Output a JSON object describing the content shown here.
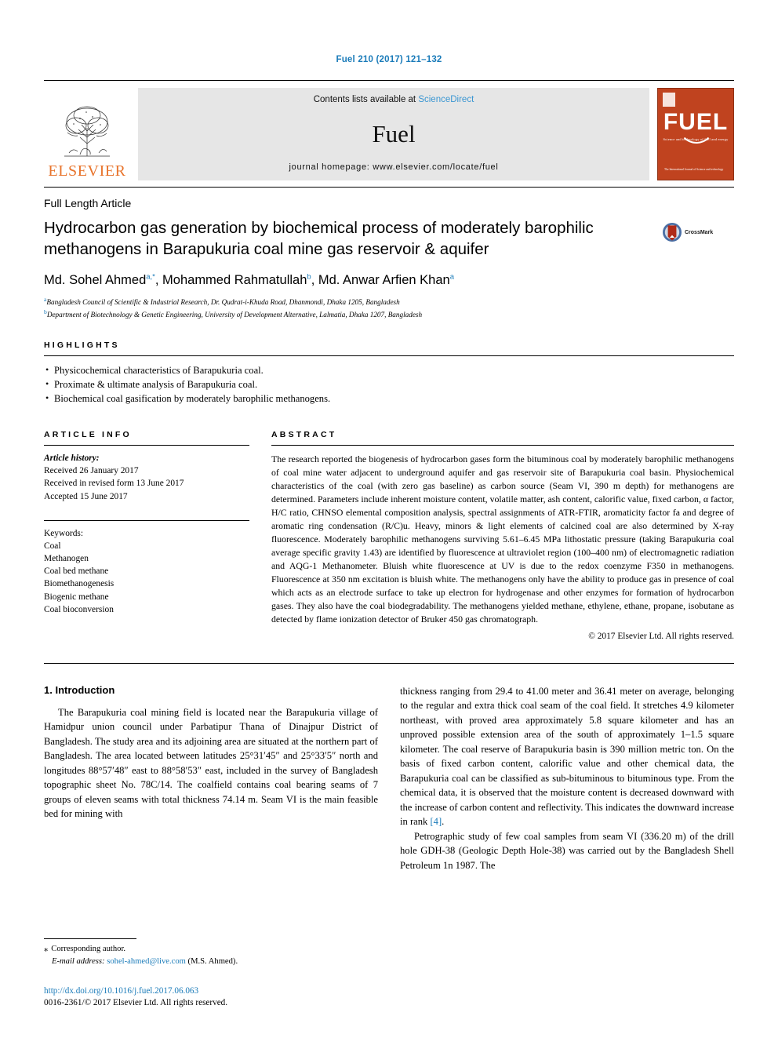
{
  "running_head": "Fuel 210 (2017) 121–132",
  "masthead": {
    "elsevier_wordmark": "ELSEVIER",
    "contents_prefix": "Contents lists available at",
    "contents_link": "ScienceDirect",
    "journal_name": "Fuel",
    "homepage_line": "journal homepage: www.elsevier.com/locate/fuel",
    "cover": {
      "title": "FUEL",
      "subtitle": "Science and technology of fuel and energy",
      "footer": "The International Journal of\nScience and technology"
    }
  },
  "article": {
    "type": "Full Length Article",
    "title": "Hydrocarbon gas generation by biochemical process of moderately barophilic methanogens in Barapukuria coal mine gas reservoir & aquifer",
    "crossmark_label": "CrossMark",
    "authors_html": "Md. Sohel Ahmed<sup>a,*</sup>, Mohammed Rahmatullah<sup>b</sup>, Md. Anwar Arfien Khan<sup>a</sup>",
    "affiliations": [
      {
        "marker": "a",
        "text": "Bangladesh Council of Scientific & Industrial Research, Dr. Qudrat-i-Khuda Road, Dhanmondi, Dhaka 1205, Bangladesh"
      },
      {
        "marker": "b",
        "text": "Department of Biotechnology & Genetic Engineering, University of Development Alternative, Lalmatia, Dhaka 1207, Bangladesh"
      }
    ]
  },
  "highlights": {
    "heading": "HIGHLIGHTS",
    "items": [
      "Physicochemical characteristics of Barapukuria coal.",
      "Proximate & ultimate analysis of Barapukuria coal.",
      "Biochemical coal gasification by moderately barophilic methanogens."
    ]
  },
  "article_info": {
    "heading": "ARTICLE INFO",
    "history_label": "Article history:",
    "history": [
      "Received 26 January 2017",
      "Received in revised form 13 June 2017",
      "Accepted 15 June 2017"
    ],
    "keywords_label": "Keywords:",
    "keywords": [
      "Coal",
      "Methanogen",
      "Coal bed methane",
      "Biomethanogenesis",
      "Biogenic methane",
      "Coal bioconversion"
    ]
  },
  "abstract": {
    "heading": "ABSTRACT",
    "text": "The research reported the biogenesis of hydrocarbon gases form the bituminous coal by moderately barophilic methanogens of coal mine water adjacent to underground aquifer and gas reservoir site of Barapukuria coal basin. Physiochemical characteristics of the coal (with zero gas baseline) as carbon source (Seam VI, 390 m depth) for methanogens are determined. Parameters include inherent moisture content, volatile matter, ash content, calorific value, fixed carbon, α factor, H/C ratio, CHNSO elemental composition analysis, spectral assignments of ATR-FTIR, aromaticity factor fa and degree of aromatic ring condensation (R/C)u. Heavy, minors & light elements of calcined coal are also determined by X-ray fluorescence. Moderately barophilic methanogens surviving 5.61–6.45 MPa lithostatic pressure (taking Barapukuria coal average specific gravity 1.43) are identified by fluorescence at ultraviolet region (100–400 nm) of electromagnetic radiation and AQG-1 Methanometer. Bluish white fluorescence at UV is due to the redox coenzyme F350 in methanogens. Fluorescence at 350 nm excitation is bluish white. The methanogens only have the ability to produce gas in presence of coal which acts as an electrode surface to take up electron for hydrogenase and other enzymes for formation of hydrocarbon gases. They also have the coal biodegradability. The methanogens yielded methane, ethylene, ethane, propane, isobutane as detected by flame ionization detector of Bruker 450 gas chromatograph.",
    "copyright": "© 2017 Elsevier Ltd. All rights reserved."
  },
  "body": {
    "section_title": "1. Introduction",
    "left_paragraph": "The Barapukuria coal mining field is located near the Barapukuria village of Hamidpur union council under Parbatipur Thana of Dinajpur District of Bangladesh. The study area and its adjoining area are situated at the northern part of Bangladesh. The area located between latitudes 25°31′45″ and 25°33′5″ north and longitudes 88°57′48″ east to 88°58′53″ east, included in the survey of Bangladesh topographic sheet No. 78C/14. The coalfield contains coal bearing seams of 7 groups of eleven seams with total thickness 74.14 m. Seam VI is the main feasible bed for mining with",
    "right_paragraph_cont": "thickness ranging from 29.4 to 41.00 meter and 36.41 meter on average, belonging to the regular and extra thick coal seam of the coal field. It stretches 4.9 kilometer northeast, with proved area approximately 5.8 square kilometer and has an unproved possible extension area of the south of approximately 1–1.5 square kilometer. The coal reserve of Barapukuria basin is 390 million metric ton. On the basis of fixed carbon content, calorific value and other chemical data, the Barapukuria coal can be classified as sub-bituminous to bituminous type. From the chemical data, it is observed that the moisture content is decreased downward with the increase of carbon content and reflectivity. This indicates the downward increase in rank ",
    "right_citation": "[4]",
    "right_citation_tail": ".",
    "right_paragraph_2": "Petrographic study of few coal samples from seam VI (336.20 m) of the drill hole GDH-38 (Geologic Depth Hole-38) was carried out by the Bangladesh Shell Petroleum 1n 1987. The"
  },
  "footnotes": {
    "corresponding_marker": "⁎",
    "corresponding_text": "Corresponding author.",
    "email_label": "E-mail address:",
    "email": "sohel-ahmed@live.com",
    "email_owner": "(M.S. Ahmed).",
    "doi": "http://dx.doi.org/10.1016/j.fuel.2017.06.063",
    "issn_line": "0016-2361/© 2017 Elsevier Ltd. All rights reserved."
  },
  "colors": {
    "link_blue": "#1a7bb9",
    "sciencedirect_blue": "#3a96d2",
    "elsevier_orange": "#e8742c",
    "cover_red": "#c0431f",
    "band_grey": "#e6e6e6"
  }
}
